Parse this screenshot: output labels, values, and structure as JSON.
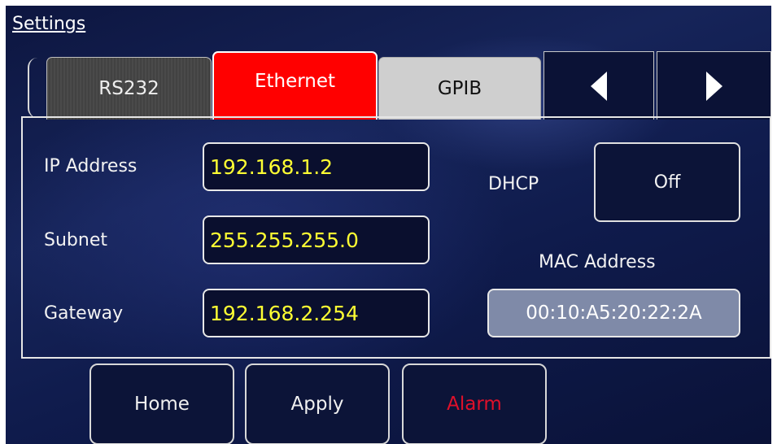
{
  "header": {
    "title": "Settings"
  },
  "tabs": [
    {
      "label": "RS232",
      "active": false
    },
    {
      "label": "Ethernet",
      "active": true
    },
    {
      "label": "GPIB",
      "active": false
    }
  ],
  "nav": {
    "prev_icon": "triangle-left-icon",
    "next_icon": "triangle-right-icon"
  },
  "ethernet": {
    "ip_label": "IP Address",
    "ip_value": "192.168.1.2",
    "subnet_label": "Subnet",
    "subnet_value": "255.255.255.0",
    "gateway_label": "Gateway",
    "gateway_value": "192.168.2.254",
    "dhcp_label": "DHCP",
    "dhcp_value": "Off",
    "mac_label": "MAC Address",
    "mac_value": "00:10:A5:20:22:2A"
  },
  "footer": {
    "home_label": "Home",
    "apply_label": "Apply",
    "alarm_label": "Alarm"
  },
  "colors": {
    "active_tab": "#ff0000",
    "field_text": "#ffff33",
    "alarm_text": "#e0102a",
    "background": "#132052"
  }
}
